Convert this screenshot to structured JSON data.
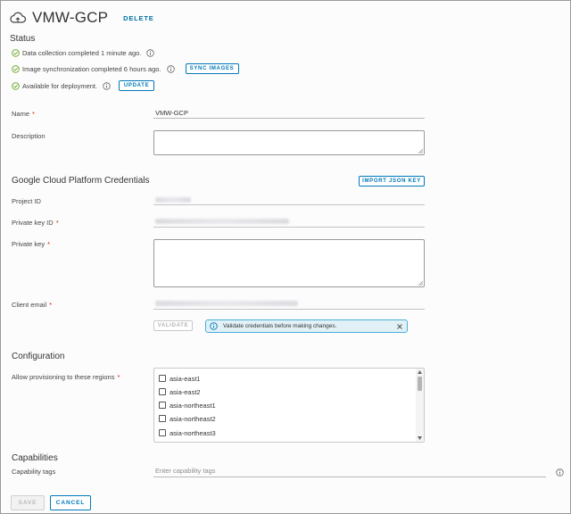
{
  "header": {
    "title": "VMW-GCP",
    "delete_label": "DELETE"
  },
  "status": {
    "section_title": "Status",
    "items": [
      {
        "text": "Data collection completed 1 minute ago."
      },
      {
        "text": "Image synchronization completed 6 hours ago.",
        "button": "SYNC IMAGES"
      },
      {
        "text": "Available for deployment.",
        "button": "UPDATE"
      }
    ]
  },
  "form": {
    "name_label": "Name",
    "name_value": "VMW-GCP",
    "description_label": "Description",
    "description_value": ""
  },
  "credentials": {
    "section_title": "Google Cloud Platform Credentials",
    "import_button": "IMPORT JSON KEY",
    "project_id_label": "Project ID",
    "private_key_id_label": "Private key ID",
    "private_key_label": "Private key",
    "client_email_label": "Client email",
    "validate_button": "VALIDATE",
    "alert_text": "Validate credentials before making changes."
  },
  "configuration": {
    "section_title": "Configuration",
    "regions_label": "Allow provisioning to these regions",
    "regions": [
      "asia-east1",
      "asia-east2",
      "asia-northeast1",
      "asia-northeast2",
      "asia-northeast3"
    ]
  },
  "capabilities": {
    "section_title": "Capabilities",
    "tags_label": "Capability tags",
    "tags_placeholder": "Enter capability tags"
  },
  "footer": {
    "save_label": "SAVE",
    "cancel_label": "CANCEL"
  },
  "colors": {
    "accent": "#0079b8",
    "success": "#62a420",
    "required": "#c92100",
    "info_alert_bg": "#e1f1f6"
  }
}
